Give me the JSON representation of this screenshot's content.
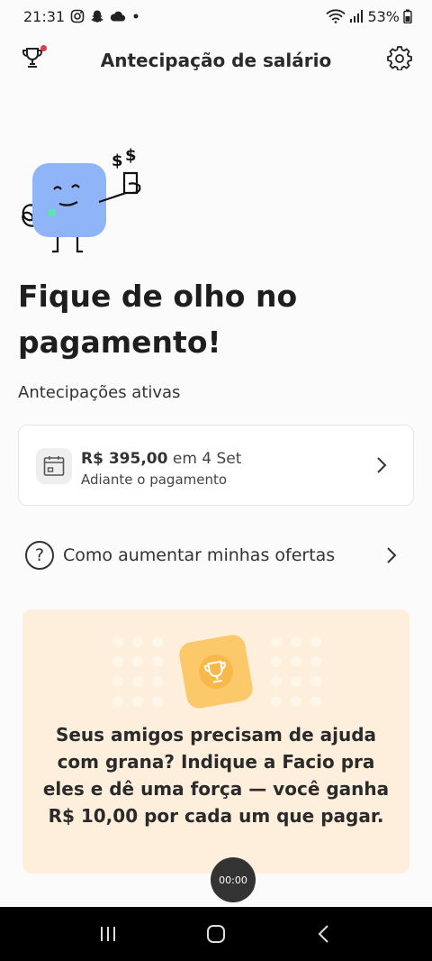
{
  "status_bar": {
    "time": "21:31",
    "battery": "53%"
  },
  "header": {
    "title": "Antecipação de salário",
    "trophy_icon": "trophy-icon",
    "settings_icon": "gear-icon"
  },
  "hero": {
    "headline_line1": "Fique de olho no",
    "headline_line2": "pagamento!"
  },
  "active_section": {
    "label": "Antecipações ativas",
    "card": {
      "amount": "R$ 395,00",
      "date_text": "em 4 Set",
      "subtitle": "Adiante o pagamento"
    }
  },
  "help": {
    "icon": "?",
    "label": "Como aumentar minhas ofertas"
  },
  "promo": {
    "text": "Seus amigos precisam de ajuda com grana? Indique a Facio pra eles e dê uma força — você ganha R$ 10,00 por cada um que pagar."
  },
  "recorder": {
    "time": "00:00"
  },
  "colors": {
    "accent_red": "#e2384d",
    "mascot_blue": "#8fb5f8",
    "promo_bg": "#fdefdc",
    "promo_trophy": "#fbc96a"
  }
}
